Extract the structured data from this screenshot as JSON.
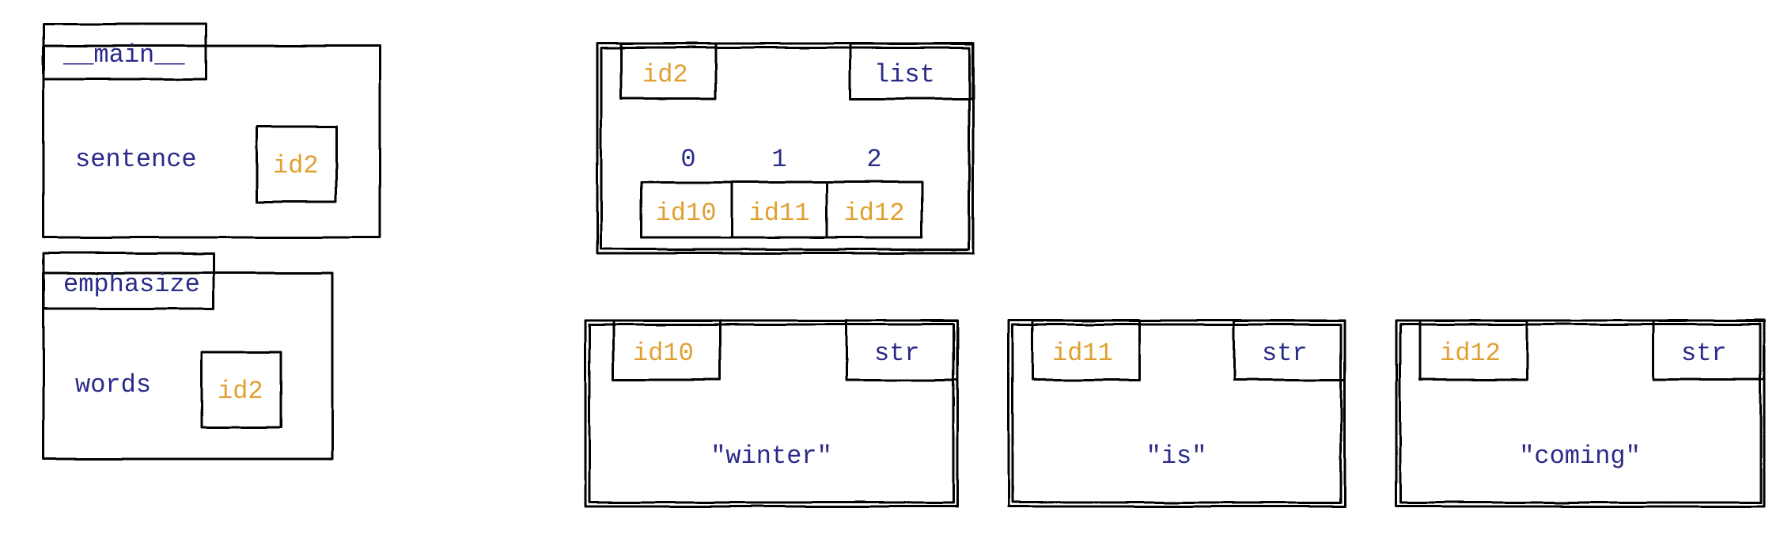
{
  "frames": {
    "main": {
      "label": "__main__",
      "var": "sentence",
      "ref": "id2"
    },
    "emphasize": {
      "label": "emphasize",
      "var": "words",
      "ref": "id2"
    }
  },
  "list_obj": {
    "id": "id2",
    "type": "list",
    "indices": [
      "0",
      "1",
      "2"
    ],
    "element_ids": [
      "id10",
      "id11",
      "id12"
    ]
  },
  "str_objs": [
    {
      "id": "id10",
      "type": "str",
      "value": "\"winter\""
    },
    {
      "id": "id11",
      "type": "str",
      "value": "\"is\""
    },
    {
      "id": "id12",
      "type": "str",
      "value": "\"coming\""
    }
  ]
}
